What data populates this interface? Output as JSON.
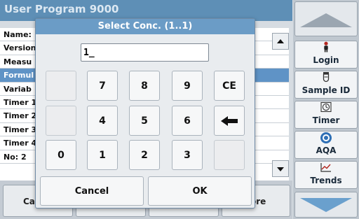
{
  "window": {
    "title": "User Program 9000"
  },
  "list": {
    "rows": [
      {
        "label": "Name:",
        "selected": false
      },
      {
        "label": "Version",
        "selected": false
      },
      {
        "label": "Measu",
        "selected": false
      },
      {
        "label": "Formul",
        "selected": true
      },
      {
        "label": "Variab",
        "selected": false
      },
      {
        "label": "Timer 1",
        "selected": false
      },
      {
        "label": "Timer 2",
        "selected": false
      },
      {
        "label": "Timer 3",
        "selected": false
      },
      {
        "label": "Timer 4",
        "selected": false
      },
      {
        "label": "No: 2",
        "selected": false
      }
    ]
  },
  "bottom_bar": {
    "left_label": "Ca",
    "right_label": "ore"
  },
  "sidebar": {
    "buttons": [
      {
        "label": "Login",
        "icon": "person-icon"
      },
      {
        "label": "Sample ID",
        "icon": "sample-id-icon"
      },
      {
        "label": "Timer",
        "icon": "timer-icon"
      },
      {
        "label": "AQA",
        "icon": "aqa-icon"
      },
      {
        "label": "Trends",
        "icon": "trends-icon"
      }
    ]
  },
  "dialog": {
    "title": "Select Conc. (1..1)",
    "input_value": "1_",
    "keys": {
      "k7": "7",
      "k8": "8",
      "k9": "9",
      "ce": "CE",
      "k4": "4",
      "k5": "5",
      "k6": "6",
      "k0": "0",
      "k1": "1",
      "k2": "2",
      "k3": "3"
    },
    "cancel_label": "Cancel",
    "ok_label": "OK"
  },
  "colors": {
    "accent": "#6b9cc6",
    "selected_row": "#5f93c6",
    "titlebar": "#5e8fb6"
  }
}
